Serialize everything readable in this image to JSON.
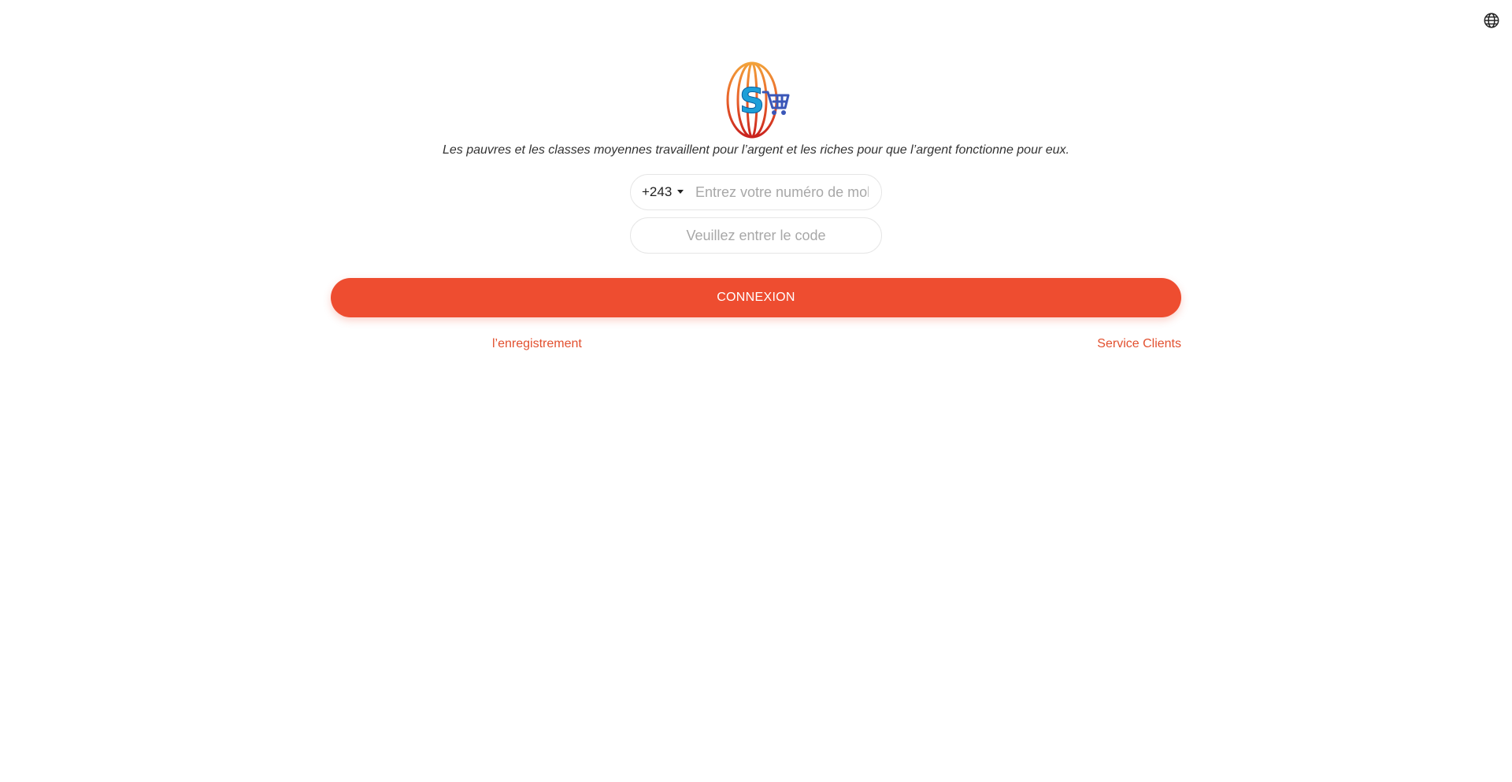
{
  "header": {
    "language_icon": "globe-icon"
  },
  "logo": {
    "icon": "globe-shopping-cart-logo",
    "letter": "S"
  },
  "slogan": "Les pauvres et les classes moyennes travaillent pour l’argent et les riches pour que l’argent fonctionne pour eux.",
  "form": {
    "country_code": "+243",
    "phone_placeholder": "Entrez votre numéro de mobile",
    "code_placeholder": "Veuillez entrer le code",
    "login_label": "CONNEXION"
  },
  "links": {
    "register": "l’enregistrement",
    "customer_service": "Service Clients"
  },
  "colors": {
    "accent": "#ee4d30",
    "link": "#e2502f"
  }
}
